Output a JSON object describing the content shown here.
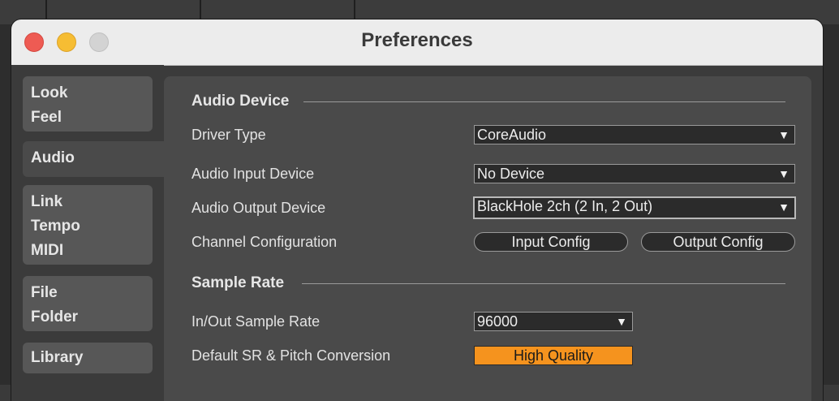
{
  "window": {
    "title": "Preferences"
  },
  "sidebar": {
    "groups": [
      {
        "items": [
          "Look",
          "Feel"
        ],
        "active": false
      },
      {
        "items": [
          "Audio"
        ],
        "active": true
      },
      {
        "items": [
          "Link",
          "Tempo",
          "MIDI"
        ],
        "active": false
      },
      {
        "items": [
          "File",
          "Folder"
        ],
        "active": false
      },
      {
        "items": [
          "Library"
        ],
        "active": false
      }
    ]
  },
  "audio_device": {
    "section_title": "Audio Device",
    "driver_type": {
      "label": "Driver Type",
      "value": "CoreAudio"
    },
    "input_device": {
      "label": "Audio Input Device",
      "value": "No Device"
    },
    "output_device": {
      "label": "Audio Output Device",
      "value": "BlackHole 2ch (2 In, 2 Out)"
    },
    "channel_config": {
      "label": "Channel Configuration",
      "input_button": "Input Config",
      "output_button": "Output Config"
    }
  },
  "sample_rate": {
    "section_title": "Sample Rate",
    "in_out_rate": {
      "label": "In/Out Sample Rate",
      "value": "96000"
    },
    "conversion": {
      "label": "Default SR & Pitch Conversion",
      "value": "High Quality"
    }
  },
  "icons": {
    "dropdown_arrow": "triangle-down-icon"
  },
  "colors": {
    "accent": "#f5931e",
    "panel": "#4a4a4a",
    "field": "#2b2b2b"
  }
}
